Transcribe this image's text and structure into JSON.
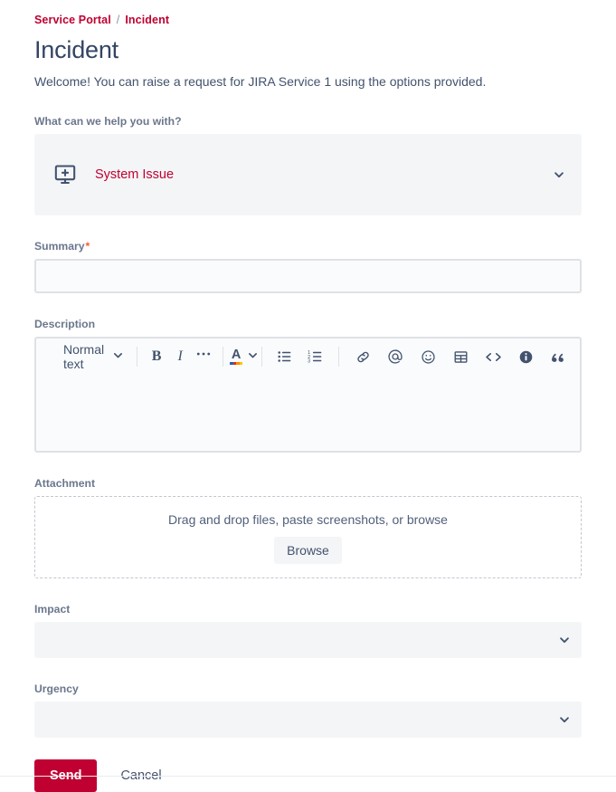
{
  "breadcrumb": {
    "items": [
      "Service Portal",
      "Incident"
    ],
    "separator": "/"
  },
  "header": {
    "title": "Incident",
    "intro": "Welcome! You can raise a request for JIRA Service 1 using the options provided."
  },
  "request_type": {
    "label": "What can we help you with?",
    "selected": "System Issue",
    "icon": "monitor-plus-icon",
    "chevron": "chevron-down-icon"
  },
  "summary": {
    "label": "Summary",
    "required_marker": "*",
    "value": "",
    "placeholder": ""
  },
  "description": {
    "label": "Description",
    "value": "",
    "toolbar": {
      "text_style": "Normal text",
      "buttons": [
        {
          "name": "bold",
          "glyph": "B"
        },
        {
          "name": "italic",
          "glyph": "I"
        },
        {
          "name": "more-formatting",
          "glyph": "•••"
        },
        {
          "name": "text-color",
          "glyph": "A"
        },
        {
          "name": "bullet-list",
          "glyph": "list"
        },
        {
          "name": "numbered-list",
          "glyph": "list-ordered"
        },
        {
          "name": "link",
          "glyph": "link"
        },
        {
          "name": "mention",
          "glyph": "@"
        },
        {
          "name": "emoji",
          "glyph": "smiley"
        },
        {
          "name": "table",
          "glyph": "table"
        },
        {
          "name": "code",
          "glyph": "<>"
        },
        {
          "name": "info-panel",
          "glyph": "info"
        },
        {
          "name": "quote",
          "glyph": "”"
        },
        {
          "name": "insert-more",
          "glyph": "+"
        },
        {
          "name": "insert-more-chevron",
          "glyph": "chevron-down"
        }
      ]
    }
  },
  "attachment": {
    "label": "Attachment",
    "drop_text": "Drag and drop files, paste screenshots, or browse",
    "browse_label": "Browse"
  },
  "impact": {
    "label": "Impact",
    "value": "",
    "chevron": "chevron-down-icon"
  },
  "urgency": {
    "label": "Urgency",
    "value": "",
    "chevron": "chevron-down-icon"
  },
  "actions": {
    "send_label": "Send",
    "cancel_label": "Cancel"
  },
  "colors": {
    "brand_red": "#BF0031",
    "label_gray": "#6B778C",
    "text_dark": "#172B4D",
    "field_bg": "#F4F5F7",
    "input_bg": "#FAFBFC",
    "border": "#DFE1E6",
    "required": "#FF5630"
  }
}
